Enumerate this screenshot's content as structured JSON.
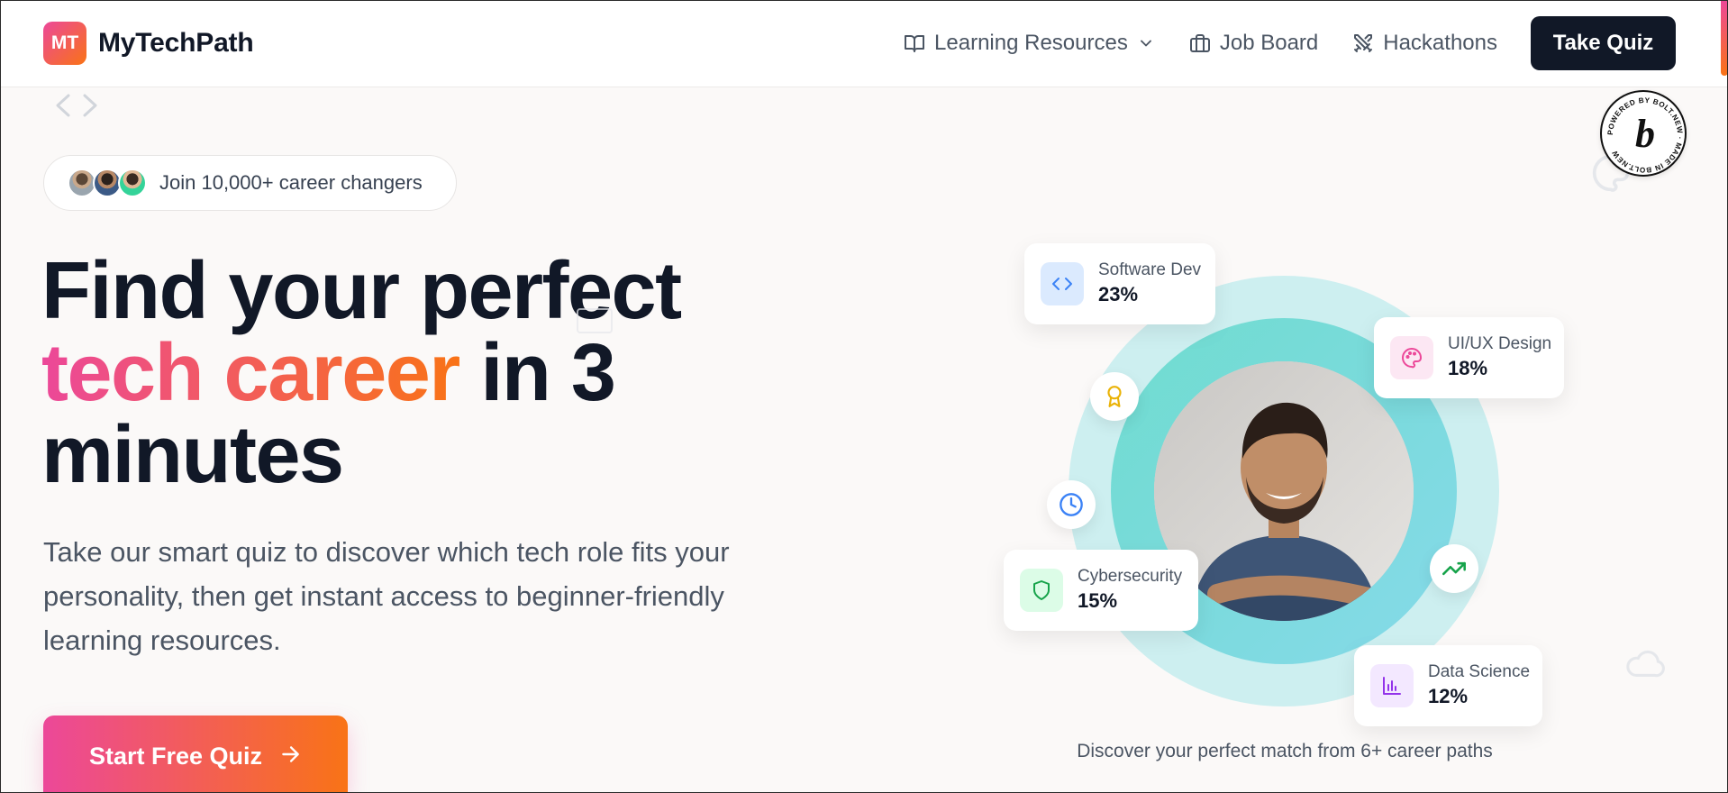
{
  "brand": {
    "logo_mark": "MT",
    "name": "MyTechPath"
  },
  "nav": {
    "items": [
      {
        "label": "Learning Resources",
        "icon": "book-icon",
        "has_dropdown": true
      },
      {
        "label": "Job Board",
        "icon": "briefcase-icon"
      },
      {
        "label": "Hackathons",
        "icon": "swords-icon"
      }
    ],
    "cta_label": "Take Quiz"
  },
  "hero": {
    "badge_text": "Join 10,000+ career changers",
    "headline_line1": "Find your perfect",
    "headline_highlight": "tech career",
    "headline_after_highlight": " in 3",
    "headline_line3": "minutes",
    "subtitle": "Take our smart quiz to discover which tech role fits your personality, then get instant access to beginner-friendly learning resources.",
    "cta_label": "Start Free Quiz"
  },
  "career_cards": [
    {
      "label": "Software Dev",
      "value": "23%",
      "icon": "code-icon",
      "color": "#3b82f6",
      "bg": "#dbeafe"
    },
    {
      "label": "UI/UX Design",
      "value": "18%",
      "icon": "palette-icon",
      "color": "#ec4899",
      "bg": "#fce7f3"
    },
    {
      "label": "Cybersecurity",
      "value": "15%",
      "icon": "shield-icon",
      "color": "#16a34a",
      "bg": "#dcfce7"
    },
    {
      "label": "Data Science",
      "value": "12%",
      "icon": "bar-chart-icon",
      "color": "#9333ea",
      "bg": "#f3e8ff"
    }
  ],
  "caption": "Discover your perfect match from 6+ career paths",
  "colors": {
    "gradient_start": "#ec4899",
    "gradient_end": "#f97316",
    "dark": "#111827",
    "ring_outer": "#cdeff0"
  },
  "bolt_badge": "POWERED BY BOLT.NEW · MADE IN BOLT.NEW"
}
